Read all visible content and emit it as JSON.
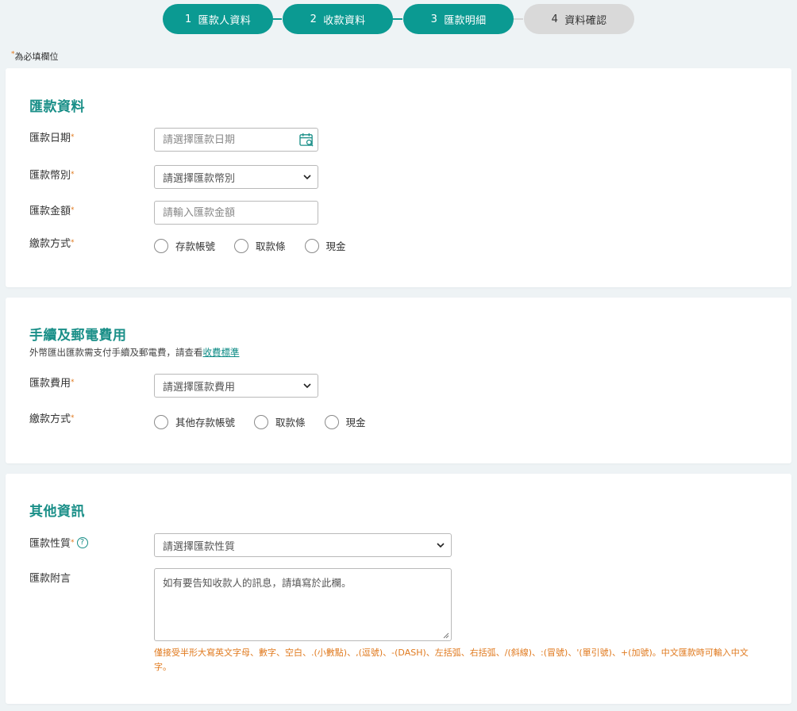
{
  "stepper": {
    "steps": [
      {
        "num": "1",
        "label": "匯款人資料",
        "state": "done"
      },
      {
        "num": "2",
        "label": "收款資料",
        "state": "done"
      },
      {
        "num": "3",
        "label": "匯款明細",
        "state": "current"
      },
      {
        "num": "4",
        "label": "資料確認",
        "state": "pending"
      }
    ],
    "active_color": "#0b9a92",
    "inactive_color": "#d9d9d9"
  },
  "required_note": "為必填欄位",
  "remit_section": {
    "title": "匯款資料",
    "date_label": "匯款日期",
    "date_placeholder": "請選擇匯款日期",
    "currency_label": "匯款幣別",
    "currency_value": "請選擇匯款幣別",
    "amount_label": "匯款金額",
    "amount_placeholder": "請輸入匯款金額",
    "payment_label": "繳款方式",
    "payment_options": [
      "存款帳號",
      "取款條",
      "現金"
    ]
  },
  "fee_section": {
    "title": "手續及郵電費用",
    "desc_text": "外幣匯出匯款需支付手續及郵電費，請查看",
    "desc_link": "收費標準",
    "fee_label": "匯款費用",
    "fee_value": "請選擇匯款費用",
    "payment_label": "繳款方式",
    "payment_options": [
      "其他存款帳號",
      "取款條",
      "現金"
    ]
  },
  "other_section": {
    "title": "其他資訊",
    "nature_label": "匯款性質",
    "nature_value": "請選擇匯款性質",
    "message_label": "匯款附言",
    "message_placeholder": "如有要告知收款人的訊息，請填寫於此欄。",
    "hint": "僅接受半形大寫英文字母、數字、空白、.(小數點)、,(逗號)、-(DASH)、左括弧、右括弧、/(斜線)、:(冒號)、'(單引號)、+(加號)。中文匯款時可輸入中文字。"
  },
  "colors": {
    "accent": "#1a8f88",
    "required_star": "#e07a1f",
    "hint": "#e07a1f"
  },
  "icons": {
    "calendar": "calendar-icon",
    "chevron": "chevron-down-icon",
    "help": "help-icon"
  }
}
